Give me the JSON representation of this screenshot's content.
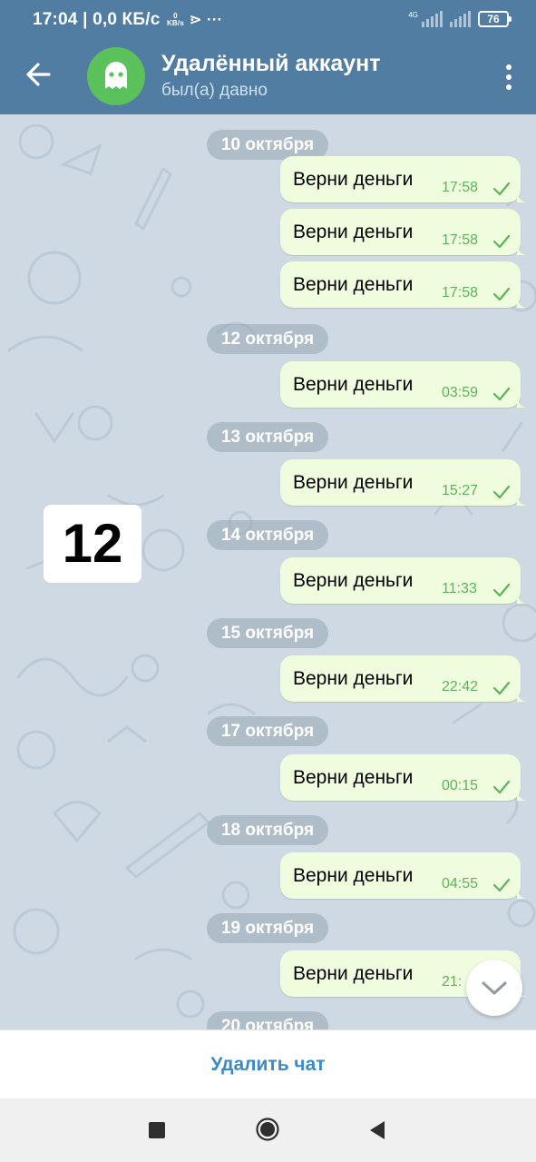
{
  "status_bar": {
    "time_speed": "17:04 | 0,0 КБ/с",
    "kbs_value": "0",
    "kbs_unit": "KB/s",
    "extra_icons": "⋗ ···",
    "network": "4G",
    "battery": "76"
  },
  "header": {
    "title": "Удалённый аккаунт",
    "subtitle": "был(а) давно",
    "avatar_icon": "ghost-icon",
    "accent_color": "#517da2"
  },
  "overlay_counter": "12",
  "messages": [
    {
      "date": "10 октября"
    },
    {
      "text": "Верни деньги",
      "time": "17:58"
    },
    {
      "text": "Верни деньги",
      "time": "17:58"
    },
    {
      "text": "Верни деньги",
      "time": "17:58"
    },
    {
      "date": "12 октября"
    },
    {
      "text": "Верни деньги",
      "time": "03:59"
    },
    {
      "date": "13 октября"
    },
    {
      "text": "Верни деньги",
      "time": "15:27"
    },
    {
      "date": "14 октября"
    },
    {
      "text": "Верни деньги",
      "time": "11:33"
    },
    {
      "date": "15 октября"
    },
    {
      "text": "Верни деньги",
      "time": "22:42"
    },
    {
      "date": "17 октября"
    },
    {
      "text": "Верни деньги",
      "time": "00:15"
    },
    {
      "date": "18 октября"
    },
    {
      "text": "Верни деньги",
      "time": "04:55"
    },
    {
      "date": "19 октября"
    },
    {
      "text": "Верни деньги",
      "time": "21:"
    },
    {
      "date": "20 октября"
    }
  ],
  "footer": {
    "delete_label": "Удалить чат",
    "delete_color": "#3a8ac9"
  }
}
